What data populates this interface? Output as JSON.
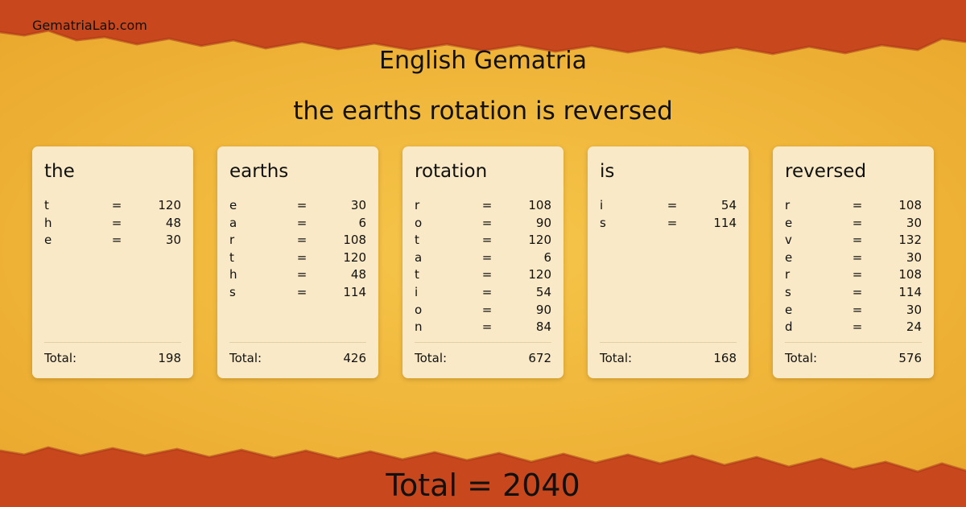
{
  "site": "GematriaLab.com",
  "mode_title": "English Gematria",
  "phrase": "the earths rotation is reversed",
  "equals_sign": "=",
  "total_label": "Total:",
  "words": [
    {
      "word": "the",
      "letters": [
        [
          "t",
          "120"
        ],
        [
          "h",
          "48"
        ],
        [
          "e",
          "30"
        ]
      ],
      "total": "198"
    },
    {
      "word": "earths",
      "letters": [
        [
          "e",
          "30"
        ],
        [
          "a",
          "6"
        ],
        [
          "r",
          "108"
        ],
        [
          "t",
          "120"
        ],
        [
          "h",
          "48"
        ],
        [
          "s",
          "114"
        ]
      ],
      "total": "426"
    },
    {
      "word": "rotation",
      "letters": [
        [
          "r",
          "108"
        ],
        [
          "o",
          "90"
        ],
        [
          "t",
          "120"
        ],
        [
          "a",
          "6"
        ],
        [
          "t",
          "120"
        ],
        [
          "i",
          "54"
        ],
        [
          "o",
          "90"
        ],
        [
          "n",
          "84"
        ]
      ],
      "total": "672"
    },
    {
      "word": "is",
      "letters": [
        [
          "i",
          "54"
        ],
        [
          "s",
          "114"
        ]
      ],
      "total": "168"
    },
    {
      "word": "reversed",
      "letters": [
        [
          "r",
          "108"
        ],
        [
          "e",
          "30"
        ],
        [
          "v",
          "132"
        ],
        [
          "e",
          "30"
        ],
        [
          "r",
          "108"
        ],
        [
          "s",
          "114"
        ],
        [
          "e",
          "30"
        ],
        [
          "d",
          "24"
        ]
      ],
      "total": "576"
    }
  ],
  "grand_total": "Total = 2040",
  "colors": {
    "border": "#c9471c",
    "paper": "#f2b93b",
    "card": "#f9e9c6"
  }
}
